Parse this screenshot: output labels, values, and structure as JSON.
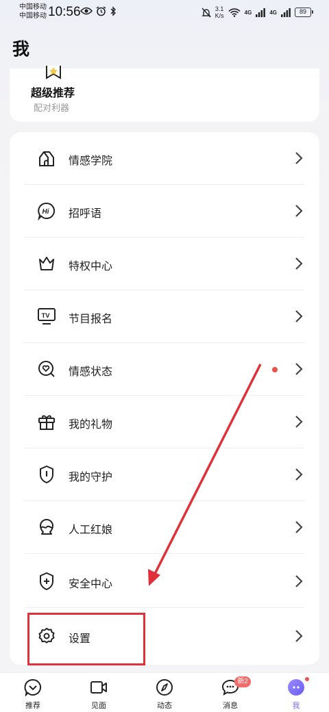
{
  "status_bar": {
    "carrier_1": "中国移动",
    "carrier_2": "中国移动",
    "time": "10:56",
    "speed_value": "3.1",
    "speed_unit": "K/s",
    "net_1": "4G",
    "net_2": "4G",
    "battery": "89"
  },
  "page": {
    "title": "我"
  },
  "super_card": {
    "title": "超级推荐",
    "subtitle": "配对利器"
  },
  "menu": {
    "items": [
      {
        "label": "情感学院",
        "icon": "academy-house-icon"
      },
      {
        "label": "招呼语",
        "icon": "hi-bubble-icon"
      },
      {
        "label": "特权中心",
        "icon": "crown-icon"
      },
      {
        "label": "节目报名",
        "icon": "tv-icon"
      },
      {
        "label": "情感状态",
        "icon": "heart-search-icon",
        "has_red_dot": true
      },
      {
        "label": "我的礼物",
        "icon": "gift-icon"
      },
      {
        "label": "我的守护",
        "icon": "shield-icon"
      },
      {
        "label": "人工红娘",
        "icon": "matchmaker-icon"
      },
      {
        "label": "安全中心",
        "icon": "shield-plus-icon"
      },
      {
        "label": "设置",
        "icon": "gear-icon"
      }
    ]
  },
  "annotation": {
    "color": "#e0303a"
  },
  "bottom_nav": {
    "items": [
      {
        "label": "推荐",
        "icon": "recommend-icon"
      },
      {
        "label": "见面",
        "icon": "video-camera-icon"
      },
      {
        "label": "动态",
        "icon": "compass-icon"
      },
      {
        "label": "消息",
        "icon": "chat-icon",
        "badge": "新2"
      },
      {
        "label": "我",
        "icon": "avatar-icon",
        "active": true
      }
    ]
  },
  "colors": {
    "accent": "#7b6cf6",
    "badge": "#f36a6a",
    "dot": "#f0504a"
  }
}
